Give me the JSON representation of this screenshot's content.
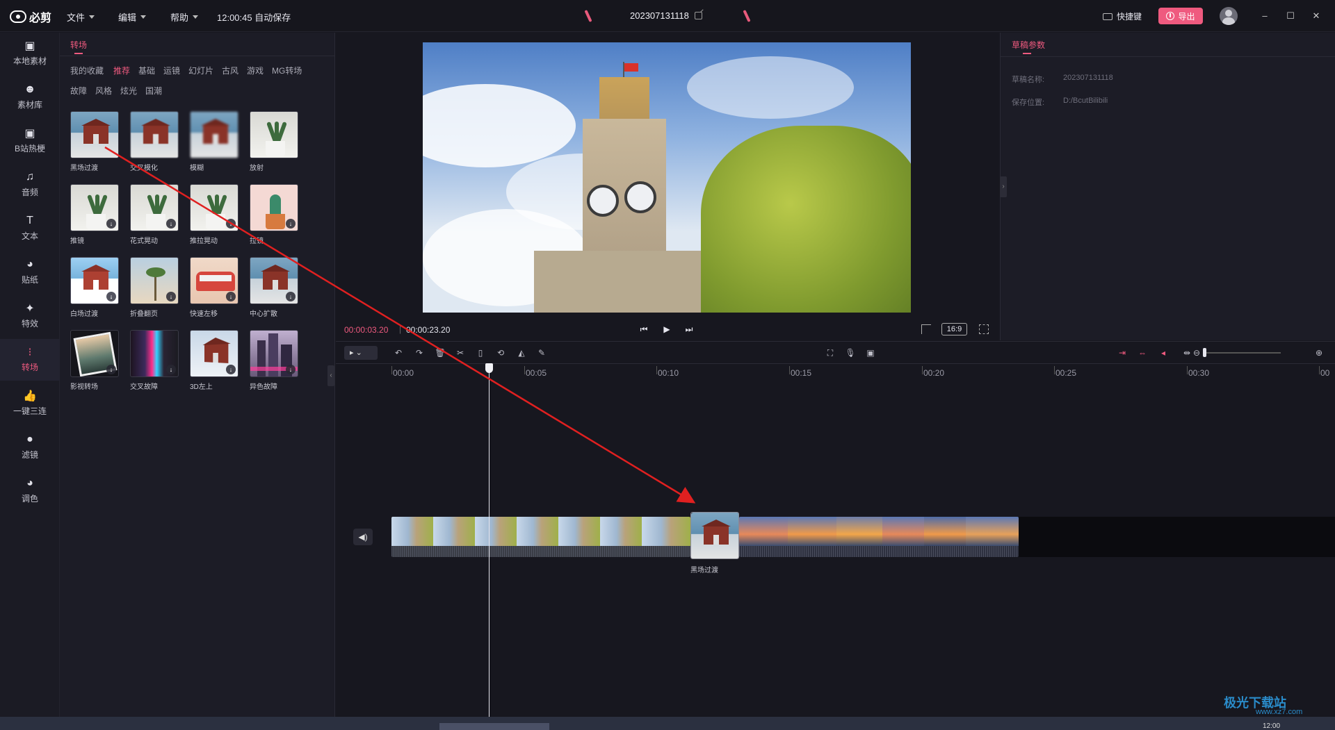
{
  "app": {
    "logo_text": "必剪",
    "menus": [
      "文件",
      "编辑",
      "帮助"
    ],
    "autosave": "12:00:45 自动保存",
    "project_title": "202307131118",
    "shortcut_label": "快捷键",
    "export_label": "导出",
    "window_controls": [
      "–",
      "☐",
      "✕"
    ]
  },
  "rail": {
    "items": [
      {
        "label": "本地素材",
        "icon": "folder-icon",
        "glyph": "▣"
      },
      {
        "label": "素材库",
        "icon": "media-library-icon",
        "glyph": "☻"
      },
      {
        "label": "B站热梗",
        "icon": "bilibili-icon",
        "glyph": "▣"
      },
      {
        "label": "音频",
        "icon": "music-icon",
        "glyph": "♫"
      },
      {
        "label": "文本",
        "icon": "text-icon",
        "glyph": "T"
      },
      {
        "label": "贴纸",
        "icon": "sticker-icon",
        "glyph": "◕"
      },
      {
        "label": "特效",
        "icon": "effects-icon",
        "glyph": "✦"
      },
      {
        "label": "转场",
        "icon": "transition-icon",
        "glyph": "⁝"
      },
      {
        "label": "一键三连",
        "icon": "thumbs-up-icon",
        "glyph": "👍"
      },
      {
        "label": "滤镜",
        "icon": "filter-icon",
        "glyph": "●"
      },
      {
        "label": "调色",
        "icon": "palette-icon",
        "glyph": "◕"
      }
    ],
    "active_index": 7
  },
  "panel": {
    "title": "转场",
    "categories": [
      "我的收藏",
      "推荐",
      "基础",
      "运镜",
      "幻灯片",
      "古风",
      "游戏",
      "MG转场",
      "故障",
      "风格",
      "炫光",
      "国潮"
    ],
    "active_category": "推荐",
    "tiles": [
      {
        "label": "黑场过渡",
        "download": false
      },
      {
        "label": "交叉模化",
        "download": false
      },
      {
        "label": "模糊",
        "download": false
      },
      {
        "label": "放射",
        "download": false
      },
      {
        "label": "推镜",
        "download": true
      },
      {
        "label": "花式晃动",
        "download": true
      },
      {
        "label": "推拉晃动",
        "download": true
      },
      {
        "label": "拉镜",
        "download": true
      },
      {
        "label": "白场过渡",
        "download": true
      },
      {
        "label": "折叠翻页",
        "download": true
      },
      {
        "label": "快速左移",
        "download": true
      },
      {
        "label": "中心扩散",
        "download": true
      },
      {
        "label": "影视转场",
        "download": true
      },
      {
        "label": "交叉故障",
        "download": true
      },
      {
        "label": "3D左上",
        "download": true
      },
      {
        "label": "异色故障",
        "download": true
      }
    ]
  },
  "preview": {
    "current_time": "00:00:03.20",
    "total_time": "00:00:23.20",
    "aspect_ratio": "16:9"
  },
  "properties": {
    "title": "草稿参数",
    "name_label": "草稿名称:",
    "name_value": "202307131118",
    "path_label": "保存位置:",
    "path_value": "D:/BcutBilibili"
  },
  "timeline": {
    "ruler_labels": [
      "00:00",
      "00:05",
      "00:10",
      "00:15",
      "00:20",
      "00:25",
      "00:30",
      "00"
    ],
    "transition_label": "黑场过渡",
    "select_tool": "▸",
    "playhead_time_seconds": 3.67
  },
  "watermark": {
    "text": "极光下载站",
    "url": "www.xz7.com"
  },
  "taskbar": {
    "clock": "12:00"
  },
  "colors": {
    "accent": "#ef5a7f",
    "background": "#17171f",
    "panel": "#1c1c26",
    "annotation_arrow": "#e02020"
  }
}
